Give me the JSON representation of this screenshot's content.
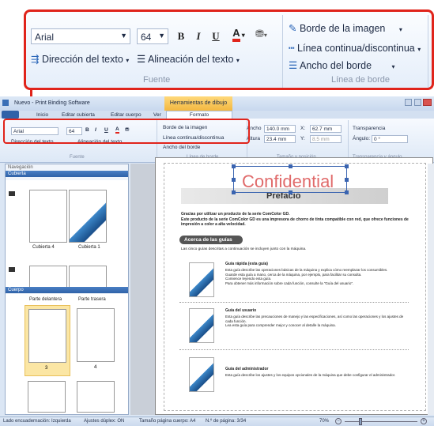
{
  "zoom": {
    "font_name": "Arial",
    "font_size": "64",
    "bold": "B",
    "italic": "I",
    "underline": "U",
    "font_color": "A",
    "text_direction": "Dirección del texto",
    "text_alignment": "Alineación del texto",
    "group_font": "Fuente",
    "image_border": "Borde de la imagen",
    "line_style": "Línea continua/discontinua",
    "border_width": "Ancho del borde",
    "group_border": "Línea de borde"
  },
  "window": {
    "title": "Nuevo - Print Binding Software",
    "drawing_tools": "Herramientas de dibujo",
    "tabs": [
      "Inicio",
      "Editar cubierta",
      "Editar cuerpo",
      "Ver"
    ],
    "format_tab": "Formato"
  },
  "ribbon": {
    "font_name": "Arial",
    "font_size": "64",
    "bold": "B",
    "italic": "I",
    "underline": "U",
    "font_color": "A",
    "text_direction": "Dirección del texto",
    "text_alignment": "Alineación del texto",
    "group_font": "Fuente",
    "image_border": "Borde de la imagen",
    "line_style": "Línea continua/discontinua",
    "border_width": "Ancho del borde",
    "group_border": "Línea de borde",
    "width_label": "Ancho",
    "width_value": "140.0 mm",
    "height_label": "Altura",
    "height_value": "23.4 mm",
    "x_label": "X:",
    "x_value": "62.7 mm",
    "y_label": "Y:",
    "y_value": "8.5 mm",
    "group_size": "Tamaño y posición",
    "transparency_label": "Transparencia",
    "angle_label": "Ángulo:",
    "angle_value": "0 °",
    "group_transparency": "Transparencia y ángulo"
  },
  "nav": {
    "title": "Navegación",
    "cover_header": "Cubierta",
    "cover_thumbs": [
      "Cubierta 4",
      "Cubierta 1"
    ],
    "body_header": "Cuerpo",
    "front_label": "Parte delantera",
    "back_label": "Parte trasera",
    "page_numbers": [
      "3",
      "4"
    ]
  },
  "document": {
    "watermark": "Confidential",
    "heading": "Prefacio",
    "intro": "Gracias por utilizar un producto de la serie ComColor GD.\nEste producto de la serie ComColor GD es una impresora de chorro de tinta compatible con red, que ofrece funciones de impresión a color a alta velocidad.",
    "section_title": "Acerca de las guías",
    "section_intro": "Las cinco guías descritas a continuación se incluyen junto con la máquina.",
    "guides": [
      {
        "title": "Guía rápida (esta guía)",
        "body": "Esta guía describe las operaciones básicas de la máquina y explica cómo reemplazar los consumibles.\nGuarde esta guía a mano, cerca de la máquina, por ejemplo, para facilitar su consulta.\nComience leyendo esta guía.\nPara obtener más información sobre cada función, consulte la \"Guía del usuario\"."
      },
      {
        "title": "Guía del usuario",
        "body": "Esta guía describe las precauciones de manejo y las especificaciones, así como las operaciones y los ajustes de cada función.\nLea esta guía para comprender mejor y conocer al detalle la máquina."
      },
      {
        "title": "Guía del administrador",
        "body": "Esta guía describe los ajustes y los equipos opcionales de la máquina que debe configurar el administrador."
      }
    ]
  },
  "status": {
    "binding_edge": "Lado encuadernación: Izquierda",
    "duplex": "Ajustes dúplex: ON",
    "page_size": "Tamaño página cuerpo: A4",
    "page_no": "N.º de página: 3/34",
    "zoom": "70%"
  },
  "colors": {
    "callout": "#e0241b",
    "accent": "#2f62a8",
    "watermark": "#e06a6a",
    "tab_drawing": "#f3b740"
  }
}
